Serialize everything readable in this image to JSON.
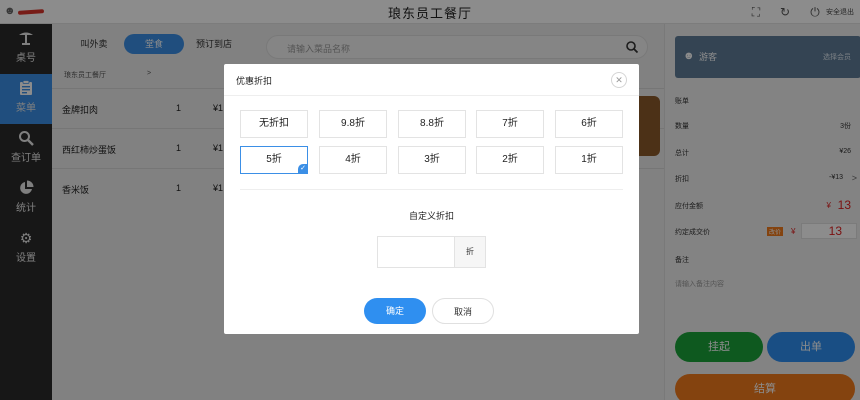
{
  "app": {
    "title": "琅东员工餐厅",
    "logout_label": "安全退出"
  },
  "sidebar": {
    "items": [
      {
        "label": "桌号",
        "icon": "table-icon"
      },
      {
        "label": "菜单",
        "icon": "menu-list-icon"
      },
      {
        "label": "查订单",
        "icon": "search-icon"
      },
      {
        "label": "统计",
        "icon": "pie-chart-icon"
      },
      {
        "label": "设置",
        "icon": "gear-icon"
      }
    ],
    "active_index": 1
  },
  "main": {
    "order_types": [
      "叫外卖",
      "堂食",
      "预订到店"
    ],
    "active_order_type": "堂食",
    "search": {
      "placeholder": "请输入菜品名称"
    },
    "order_header": {
      "name": "琅东员工餐厅",
      "arrow": ">"
    },
    "order_rows": [
      {
        "name": "金牌扣肉",
        "qty": "1",
        "price": "¥1"
      },
      {
        "name": "西红柿炒蛋饭",
        "qty": "1",
        "price": "¥1"
      },
      {
        "name": "香米饭",
        "qty": "1",
        "price": "¥1"
      }
    ]
  },
  "right": {
    "guest": {
      "name": "游客",
      "member_label": "选择会员"
    },
    "bill_title": "账单",
    "lines": [
      {
        "label": "数量",
        "value": "3份"
      },
      {
        "label": "总计",
        "value": "¥26"
      },
      {
        "label": "折扣",
        "value": "-¥13"
      }
    ],
    "payable": {
      "label": "应付金额",
      "currency": "¥",
      "value": "13"
    },
    "actual": {
      "label": "约定成交价",
      "badge": "改价",
      "currency": "¥",
      "value": "13"
    },
    "note": {
      "label": "备注",
      "placeholder": "请输入备注内容"
    },
    "buttons": {
      "hold": "挂起",
      "send": "出单",
      "checkout": "结算"
    }
  },
  "modal": {
    "title": "优惠折扣",
    "options": [
      "无折扣",
      "9.8折",
      "8.8折",
      "7折",
      "6折",
      "5折",
      "4折",
      "3折",
      "2折",
      "1折"
    ],
    "selected": "5折",
    "custom_label": "自定义折扣",
    "custom_value": "",
    "custom_unit": "折",
    "confirm_label": "确定",
    "cancel_label": "取消"
  },
  "colors": {
    "accent": "#3b8fe6",
    "sidebar_bg": "#2b2b2b",
    "guest_bg": "#5f7d98",
    "hold": "#1aa33a",
    "send": "#2f8ff0",
    "checkout": "#f07a1c",
    "price_red": "#e02020"
  }
}
